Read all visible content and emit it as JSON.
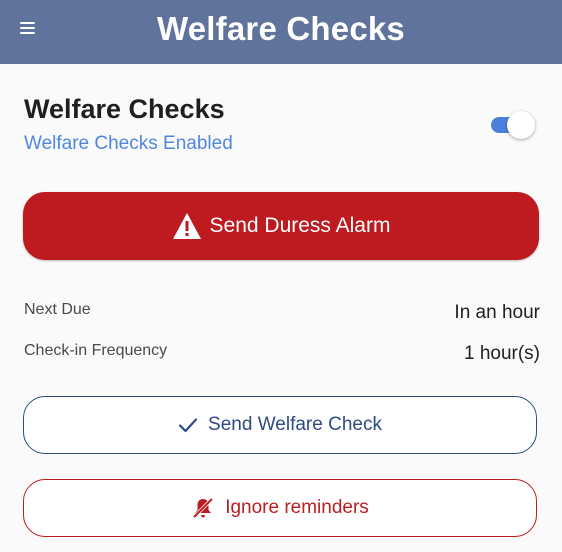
{
  "header": {
    "title": "Welfare Checks",
    "menu_icon": "hamburger-menu-icon"
  },
  "section": {
    "title": "Welfare Checks",
    "status": "Welfare Checks Enabled",
    "toggle_on": true
  },
  "duress": {
    "label": "Send Duress Alarm",
    "icon": "warning-triangle-icon"
  },
  "info": {
    "next_due_label": "Next Due",
    "next_due_value": "In an hour",
    "frequency_label": "Check-in Frequency",
    "frequency_value": "1 hour(s)"
  },
  "actions": {
    "welfare_label": "Send Welfare Check",
    "welfare_icon": "checkmark-icon",
    "ignore_label": "Ignore reminders",
    "ignore_icon": "bell-off-icon"
  },
  "colors": {
    "header_bg": "#5f739c",
    "accent_blue": "#4f87de",
    "duress_red": "#bd1b1f",
    "navy": "#2f4a85"
  }
}
